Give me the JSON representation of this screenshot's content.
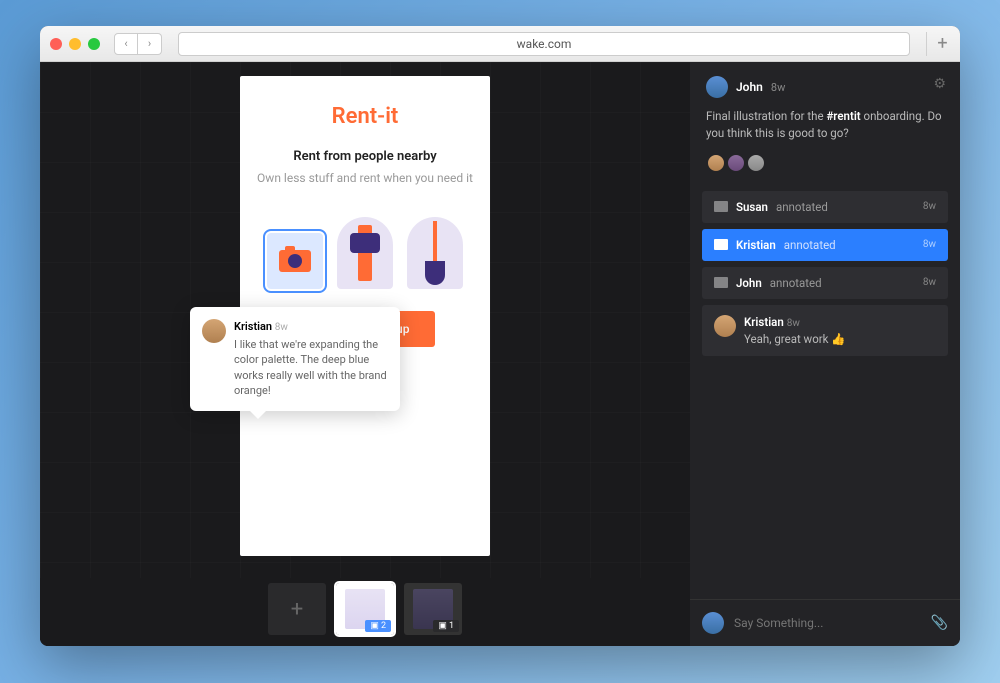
{
  "browser": {
    "url": "wake.com"
  },
  "artboard": {
    "brand": "Rent-it",
    "headline": "Rent from people nearby",
    "subline": "Own less stuff and rent when you need it",
    "cta": "Log in or sign up",
    "brand_color": "#ff6b35"
  },
  "annotation_popup": {
    "author": "Kristian",
    "timestamp": "8w",
    "body": "I like that we're expanding the color palette. The deep blue works really well with the brand orange!"
  },
  "thumbnails": [
    {
      "type": "add"
    },
    {
      "type": "artboard",
      "active": true,
      "badge": "2"
    },
    {
      "type": "artboard",
      "active": false,
      "badge": "1"
    }
  ],
  "post": {
    "author": "John",
    "timestamp": "8w",
    "description_pre": "Final illustration for the ",
    "description_tag": "#rentit",
    "description_post": " onboarding. Do you think this is good to go?"
  },
  "annotations": [
    {
      "author": "Susan",
      "action": "annotated",
      "timestamp": "8w",
      "selected": false
    },
    {
      "author": "Kristian",
      "action": "annotated",
      "timestamp": "8w",
      "selected": true
    },
    {
      "author": "John",
      "action": "annotated",
      "timestamp": "8w",
      "selected": false
    }
  ],
  "comments": [
    {
      "author": "Kristian",
      "timestamp": "8w",
      "text": "Yeah, great work 👍"
    }
  ],
  "composer": {
    "placeholder": "Say Something..."
  }
}
